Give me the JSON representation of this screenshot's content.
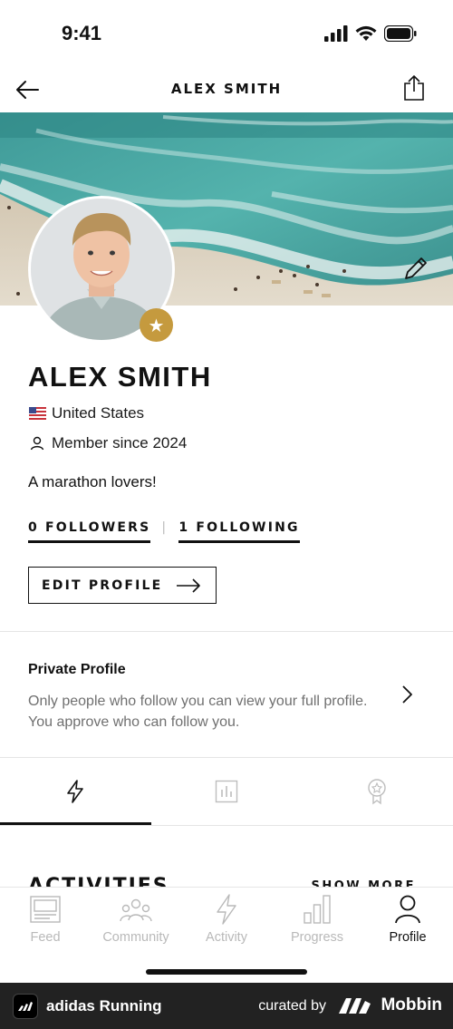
{
  "status_bar": {
    "time": "9:41"
  },
  "header": {
    "title": "ALEX SMITH"
  },
  "profile": {
    "name": "ALEX SMITH",
    "country": "United States",
    "member_since": "Member since 2024",
    "bio": "A marathon lovers!",
    "followers_label": "0 FOLLOWERS",
    "separator": "|",
    "following_label": "1 FOLLOWING",
    "edit_label": "EDIT PROFILE"
  },
  "privacy": {
    "title": "Private Profile",
    "description": "Only people who follow you can view your full profile. You approve who can follow you."
  },
  "tabs": [
    {
      "icon": "bolt-icon",
      "active": true
    },
    {
      "icon": "bar-chart-icon",
      "active": false
    },
    {
      "icon": "award-icon",
      "active": false
    }
  ],
  "activities": {
    "heading": "ACTIVITIES",
    "show_more": "SHOW MORE"
  },
  "bottom_nav": [
    {
      "label": "Feed",
      "icon": "feed-icon",
      "active": false
    },
    {
      "label": "Community",
      "icon": "community-icon",
      "active": false
    },
    {
      "label": "Activity",
      "icon": "bolt-icon",
      "active": false
    },
    {
      "label": "Progress",
      "icon": "bar-chart-icon",
      "active": false
    },
    {
      "label": "Profile",
      "icon": "person-icon",
      "active": true
    }
  ],
  "footer": {
    "app_name": "adidas Running",
    "curated_by": "curated by",
    "brand": "Mobbin"
  },
  "colors": {
    "accent_gold": "#c59a3e",
    "text": "#111111",
    "muted": "#b9b9b9",
    "footer_bg": "#222222"
  }
}
